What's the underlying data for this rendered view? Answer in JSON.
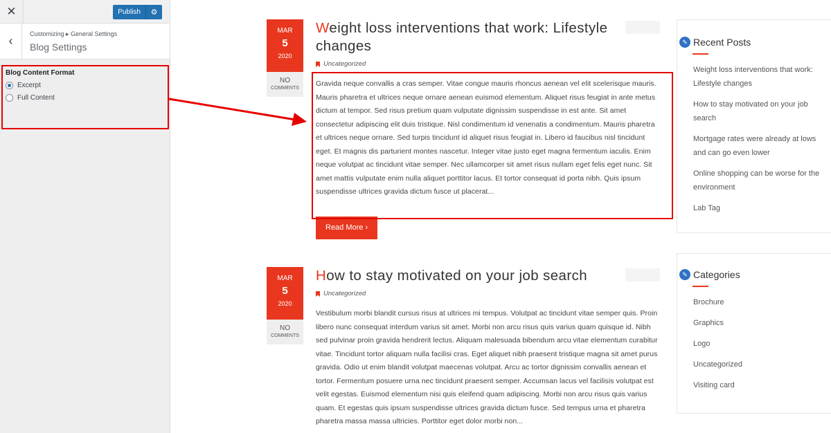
{
  "customizer": {
    "close_symbol": "✕",
    "publish_label": "Publish",
    "gear_symbol": "⚙",
    "back_symbol": "‹",
    "breadcrumb": "Customizing ▸ General Settings",
    "section_title": "Blog Settings",
    "control_title": "Blog Content Format",
    "options": [
      {
        "label": "Excerpt",
        "checked": true
      },
      {
        "label": "Full Content",
        "checked": false
      }
    ]
  },
  "colors": {
    "accent": "#e8371e",
    "highlight": "#e60000",
    "wp_blue": "#2271b1"
  },
  "posts": [
    {
      "month": "MAR",
      "day": "5",
      "year": "2020",
      "comments_no": "NO",
      "comments_label": "COMMENTS",
      "title_first": "W",
      "title_rest": "eight loss interventions that work: Lifestyle changes",
      "category": "Uncategorized",
      "excerpt": "Gravida neque convallis a cras semper. Vitae congue mauris rhoncus aenean vel elit scelerisque mauris. Mauris pharetra et ultrices neque ornare aenean euismod elementum. Aliquet risus feugiat in ante metus dictum at tempor. Sed risus pretium quam vulputate dignissim suspendisse in est ante. Sit amet consectetur adipiscing elit duis tristique. Nisl condimentum id venenatis a condimentum. Mauris pharetra et ultrices neque ornare. Sed turpis tincidunt id aliquet risus feugiat in. Libero id faucibus nisl tincidunt eget. Et magnis dis parturient montes nascetur. Integer vitae justo eget magna fermentum iaculis. Enim neque volutpat ac tincidunt vitae semper. Nec ullamcorper sit amet risus nullam eget felis eget nunc. Sit amet mattis vulputate enim nulla aliquet porttitor lacus. Et tortor consequat id porta nibh. Quis ipsum suspendisse ultrices gravida dictum fusce ut placerat...",
      "read_more": "Read More ›"
    },
    {
      "month": "MAR",
      "day": "5",
      "year": "2020",
      "comments_no": "NO",
      "comments_label": "COMMENTS",
      "title_first": "H",
      "title_rest": "ow to stay motivated on your job search",
      "category": "Uncategorized",
      "excerpt": "Vestibulum morbi blandit cursus risus at ultrices mi tempus. Volutpat ac tincidunt vitae semper quis. Proin libero nunc consequat interdum varius sit amet. Morbi non arcu risus quis varius quam quisque id. Nibh sed pulvinar proin gravida hendrerit lectus. Aliquam malesuada bibendum arcu vitae elementum curabitur vitae. Tincidunt tortor aliquam nulla facilisi cras. Eget aliquet nibh praesent tristique magna sit amet purus gravida. Odio ut enim blandit volutpat maecenas volutpat. Arcu ac tortor dignissim convallis aenean et tortor. Fermentum posuere urna nec tincidunt praesent semper. Accumsan lacus vel facilisis volutpat est velit egestas. Euismod elementum nisi quis eleifend quam adipiscing. Morbi non arcu risus quis varius quam. Et egestas quis ipsum suspendisse ultrices gravida dictum fusce. Sed tempus urna et pharetra pharetra massa massa ultricies. Porttitor eget dolor morbi non..."
    }
  ],
  "recent_posts": {
    "title": "Recent Posts",
    "items": [
      "Weight loss interventions that work: Lifestyle changes",
      "How to stay motivated on your job search",
      "Mortgage rates were already at lows and can go even lower",
      "Online shopping can be worse for the environment",
      "Lab Tag"
    ]
  },
  "categories": {
    "title": "Categories",
    "items": [
      "Brochure",
      "Graphics",
      "Logo",
      "Uncategorized",
      "Visiting card"
    ]
  }
}
